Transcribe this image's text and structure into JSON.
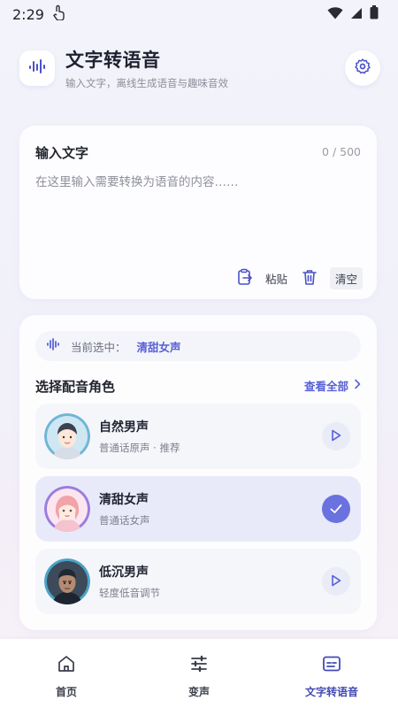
{
  "status_bar": {
    "time": "2:29"
  },
  "app": {
    "title": "文字转语音",
    "subtitle": "输入文字，离线生成语音与趣味音效"
  },
  "input": {
    "label": "输入文字",
    "counter": "0 / 500",
    "placeholder": "在这里输入需要转换为语音的内容……",
    "value": "",
    "paste_label": "粘贴",
    "clear_label": "清空"
  },
  "voices": {
    "current_prefix": "当前选中：",
    "current_value": "清甜女声",
    "section_title": "选择配音角色",
    "view_all": "查看全部",
    "items": [
      {
        "name": "自然男声",
        "desc": "普通话原声 · 推荐",
        "selected": false
      },
      {
        "name": "清甜女声",
        "desc": "普通话女声",
        "selected": true
      },
      {
        "name": "低沉男声",
        "desc": "轻度低音调节",
        "selected": false
      }
    ]
  },
  "nav": {
    "items": [
      {
        "label": "首页",
        "icon": "home-icon",
        "active": false
      },
      {
        "label": "变声",
        "icon": "sliders-icon",
        "active": false
      },
      {
        "label": "文字转语音",
        "icon": "subtitles-icon",
        "active": true
      }
    ]
  },
  "colors": {
    "accent": "#5861d6",
    "check_bg": "#6a72e0",
    "selected_bg": "#e9eaf9"
  }
}
